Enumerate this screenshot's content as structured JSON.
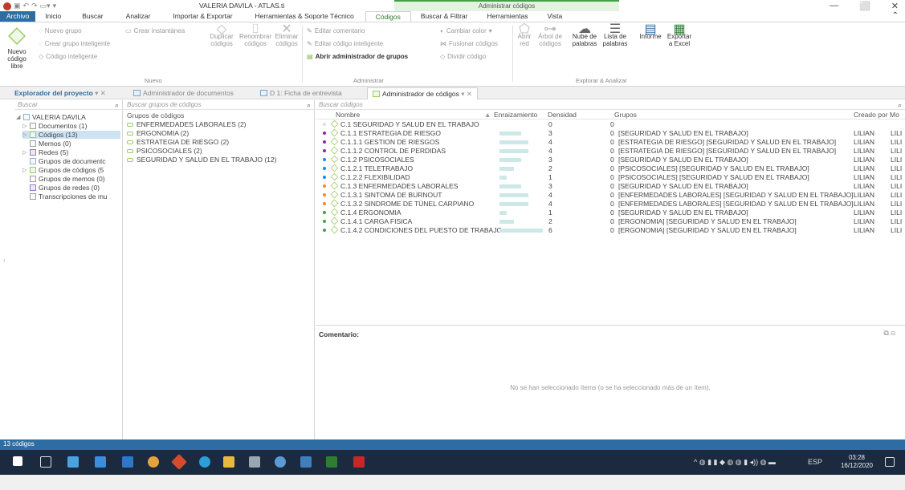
{
  "window": {
    "title": "VALERIA DAVILA - ATLAS.ti",
    "context_title": "Administrar códigos",
    "controls": [
      "—",
      "⬜",
      "✕"
    ]
  },
  "ribbon_tabs": [
    "Archivo",
    "Inicio",
    "Buscar",
    "Analizar",
    "Importar & Exportar",
    "Herramientas & Soporte Técnico",
    "Códigos",
    "Buscar & Filtrar",
    "Herramientas",
    "Vista"
  ],
  "ribbon": {
    "nuevo_codigo": "Nuevo código libre",
    "nuevo_grupo": "Nuevo grupo",
    "crear_grupo_inteligente": "Crear grupo inteligente",
    "codigo_inteligente": "Código inteligente",
    "crear_instantanea": "Crear instantánea",
    "duplicar": "Duplicar códigos",
    "renombrar": "Renombrar códigos",
    "eliminar": "Eliminar códigos",
    "group_nuevo": "Nuevo",
    "editar_comentario": "Editar comentario",
    "editar_codigo_inteligente": "Editar código inteligente",
    "abrir_admin_grupos": "Abrir administrador de grupos",
    "cambiar_color": "Cambiar color",
    "fusionar": "Fusionar códigos",
    "dividir": "Dividir código",
    "group_administrar": "Administrar",
    "abrir_red": "Abrir red",
    "arbol_codigos": "Árbol de códigos",
    "nube_palabras": "Nube de palabras",
    "lista_palabras": "Lista de palabras",
    "informe": "Informe",
    "exportar_excel": "Exportar a Excel",
    "group_explorar": "Explorar & Analizar"
  },
  "doc_tabs": {
    "explorer": "Explorador del proyecto",
    "admin_docs": "Administrador de documentos",
    "ficha": "D 1: Ficha de entrevista",
    "admin_codigos": "Administrador de códigos"
  },
  "explorer": {
    "search_placeholder": "Buscar",
    "items": [
      {
        "label": "VALERIA DAVILA"
      },
      {
        "label": "Documentos (1)"
      },
      {
        "label": "Códigos (13)"
      },
      {
        "label": "Memos (0)"
      },
      {
        "label": "Redes (5)"
      },
      {
        "label": "Grupos de documentc"
      },
      {
        "label": "Grupos de códigos (5"
      },
      {
        "label": "Grupos de memos (0)"
      },
      {
        "label": "Grupos de redes (0)"
      },
      {
        "label": "Transcripciones de mu"
      }
    ]
  },
  "groups_pane": {
    "search_placeholder": "Buscar grupos de códigos",
    "header": "Grupos de códigos",
    "items": [
      "ENFERMEDADES LABORALES (2)",
      "ERGONOMIA (2)",
      "ESTRATEGIA DE RIESGO (2)",
      "PSICOSOCIALES (2)",
      "SEGURIDAD Y SALUD EN EL TRABAJO (12)"
    ]
  },
  "codes_table": {
    "search_placeholder": "Buscar códigos",
    "columns": [
      "Nombre",
      "Enraizamiento",
      "Densidad",
      "Grupos",
      "Creado por",
      "Mo"
    ],
    "rows": [
      {
        "name": "C.1 SEGURIDAD Y SALUD EN EL TRABAJO",
        "enraizamiento": "0",
        "densidad": "0",
        "grupos": "",
        "creado": "",
        "mo": "",
        "dot": "#dddddd",
        "bar": 0
      },
      {
        "name": "C.1.1 ESTRATEGIA DE RIESGO",
        "enraizamiento": "3",
        "densidad": "0",
        "grupos": "[SEGURIDAD Y SALUD EN EL TRABAJO]",
        "creado": "LILIAN",
        "mo": "LILI",
        "dot": "#8e24aa",
        "bar": 3
      },
      {
        "name": "C.1.1.1 GESTION DE RIESGOS",
        "enraizamiento": "4",
        "densidad": "0",
        "grupos": "[ESTRATEGIA DE RIESGO] [SEGURIDAD Y SALUD EN EL TRABAJO]",
        "creado": "LILIAN",
        "mo": "LILI",
        "dot": "#8e24aa",
        "bar": 4
      },
      {
        "name": "C.1.1.2  CONTROL DE PERDIDAS",
        "enraizamiento": "4",
        "densidad": "0",
        "grupos": "[ESTRATEGIA DE RIESGO] [SEGURIDAD Y SALUD EN EL TRABAJO]",
        "creado": "LILIAN",
        "mo": "LILI",
        "dot": "#8e24aa",
        "bar": 4
      },
      {
        "name": "C.1.2  PSICOSOCIALES",
        "enraizamiento": "3",
        "densidad": "0",
        "grupos": "[SEGURIDAD Y SALUD EN EL TRABAJO]",
        "creado": "LILIAN",
        "mo": "LILI",
        "dot": "#1e88e5",
        "bar": 3
      },
      {
        "name": "C.1.2.1 TELETRABAJO",
        "enraizamiento": "2",
        "densidad": "0",
        "grupos": "[PSICOSOCIALES] [SEGURIDAD Y SALUD EN EL TRABAJO]",
        "creado": "LILIAN",
        "mo": "LILI",
        "dot": "#1e88e5",
        "bar": 2
      },
      {
        "name": "C.1.2.2 FLEXIBILIDAD",
        "enraizamiento": "1",
        "densidad": "0",
        "grupos": "[PSICOSOCIALES] [SEGURIDAD Y SALUD EN EL TRABAJO]",
        "creado": "LILIAN",
        "mo": "LILI",
        "dot": "#1e88e5",
        "bar": 1
      },
      {
        "name": "C.1.3 ENFERMEDADES LABORALES",
        "enraizamiento": "3",
        "densidad": "0",
        "grupos": "[SEGURIDAD Y SALUD EN EL TRABAJO]",
        "creado": "LILIAN",
        "mo": "LILI",
        "dot": "#fb8c00",
        "bar": 3
      },
      {
        "name": "C.1.3.1 SINTOMA DE BURNOUT",
        "enraizamiento": "4",
        "densidad": "0",
        "grupos": "[ENFERMEDADES LABORALES] [SEGURIDAD Y SALUD EN EL TRABAJO]",
        "creado": "LILIAN",
        "mo": "LILI",
        "dot": "#fb8c00",
        "bar": 4
      },
      {
        "name": "C.1.3.2 SINDROME DE TÚNEL CARPIANO",
        "enraizamiento": "4",
        "densidad": "0",
        "grupos": "[ENFERMEDADES LABORALES] [SEGURIDAD Y SALUD EN EL TRABAJO]",
        "creado": "LILIAN",
        "mo": "LILI",
        "dot": "#fb8c00",
        "bar": 4
      },
      {
        "name": "C.1.4 ERGONOMIA",
        "enraizamiento": "1",
        "densidad": "0",
        "grupos": "[SEGURIDAD Y SALUD EN EL TRABAJO]",
        "creado": "LILIAN",
        "mo": "LILI",
        "dot": "#43a047",
        "bar": 1
      },
      {
        "name": "C.1.4.1 CARGA FISICA",
        "enraizamiento": "2",
        "densidad": "0",
        "grupos": "[ERGONOMIA] [SEGURIDAD Y SALUD EN EL TRABAJO]",
        "creado": "LILIAN",
        "mo": "LILI",
        "dot": "#43a047",
        "bar": 2
      },
      {
        "name": "C.1.4.2 CONDICIONES DEL PUESTO DE TRABAJO",
        "enraizamiento": "6",
        "densidad": "0",
        "grupos": "[ERGONOMIA] [SEGURIDAD Y SALUD EN EL TRABAJO]",
        "creado": "LILIAN",
        "mo": "LILI",
        "dot": "#43a047",
        "bar": 6
      }
    ]
  },
  "comment": {
    "label": "Comentario:",
    "empty_message": "No se han seleccionado ítems (o se ha seleccionado más de un ítem)."
  },
  "status": {
    "text": "13 códigos"
  },
  "taskbar": {
    "lang": "ESP",
    "time": "03:28",
    "date": "16/12/2020"
  },
  "colors": {
    "accent_blue": "#2e6da4",
    "context_green": "#43a047",
    "taskbar": "#1b2a3f"
  }
}
